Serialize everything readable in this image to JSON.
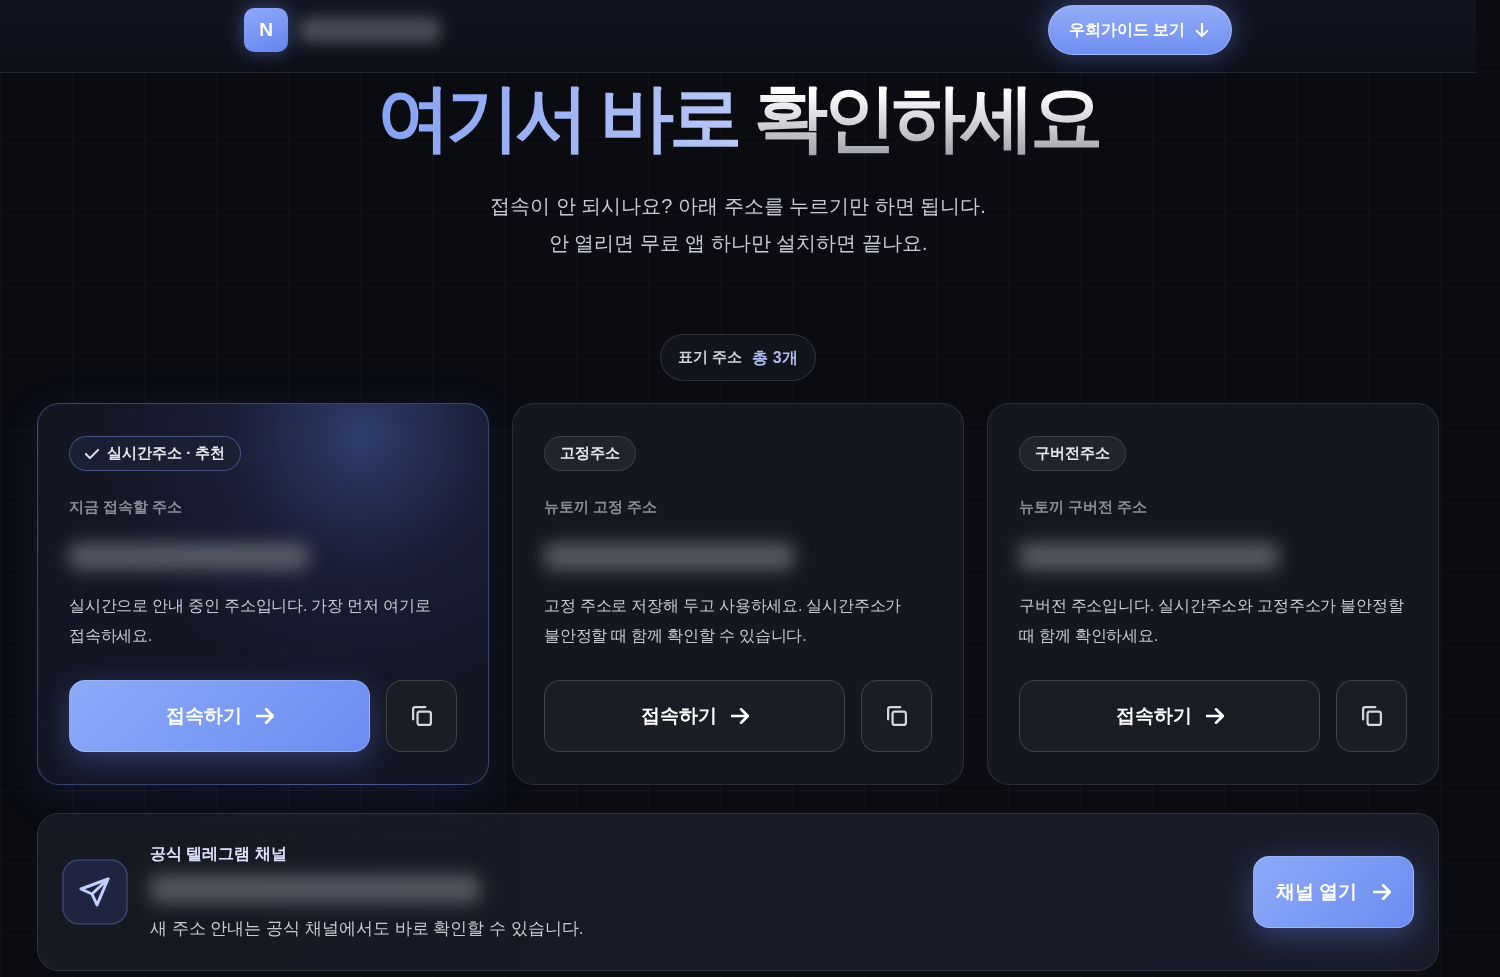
{
  "header": {
    "logo": "N",
    "guide_button": "우회가이드 보기"
  },
  "hero": {
    "headline": [
      {
        "text": "여기서 바로",
        "kind": "accent"
      },
      {
        "text": "확인하세요",
        "kind": "plain"
      }
    ],
    "subtitle_lines": [
      "접속이 안 되시나요? 아래 주소를 누르기만 하면 됩니다.",
      "안 열리면 무료 앱 하나만 설치하면 끝나요."
    ]
  },
  "address_count": {
    "label": "표기 주소",
    "value": "총 3개"
  },
  "cards": [
    {
      "tag": "실시간주소 · 추천",
      "recommended": true,
      "label": "지금 접속할 주소",
      "description": "실시간으로 안내 중인 주소입니다. 가장 먼저 여기로 접속하세요.",
      "button": "접속하기"
    },
    {
      "tag": "고정주소",
      "recommended": false,
      "label": "뉴토끼 고정 주소",
      "description": "고정 주소로 저장해 두고 사용하세요. 실시간주소가 불안정할 때 함께 확인할 수 있습니다.",
      "button": "접속하기"
    },
    {
      "tag": "구버전주소",
      "recommended": false,
      "label": "뉴토끼 구버전 주소",
      "description": "구버전 주소입니다. 실시간주소와 고정주소가 불안정할 때 함께 확인하세요.",
      "button": "접속하기"
    }
  ],
  "channel": {
    "title": "공식 텔레그램 채널",
    "description": "새 주소 안내는 공식 채널에서도 바로 확인할 수 있습니다.",
    "button": "채널 열기"
  }
}
